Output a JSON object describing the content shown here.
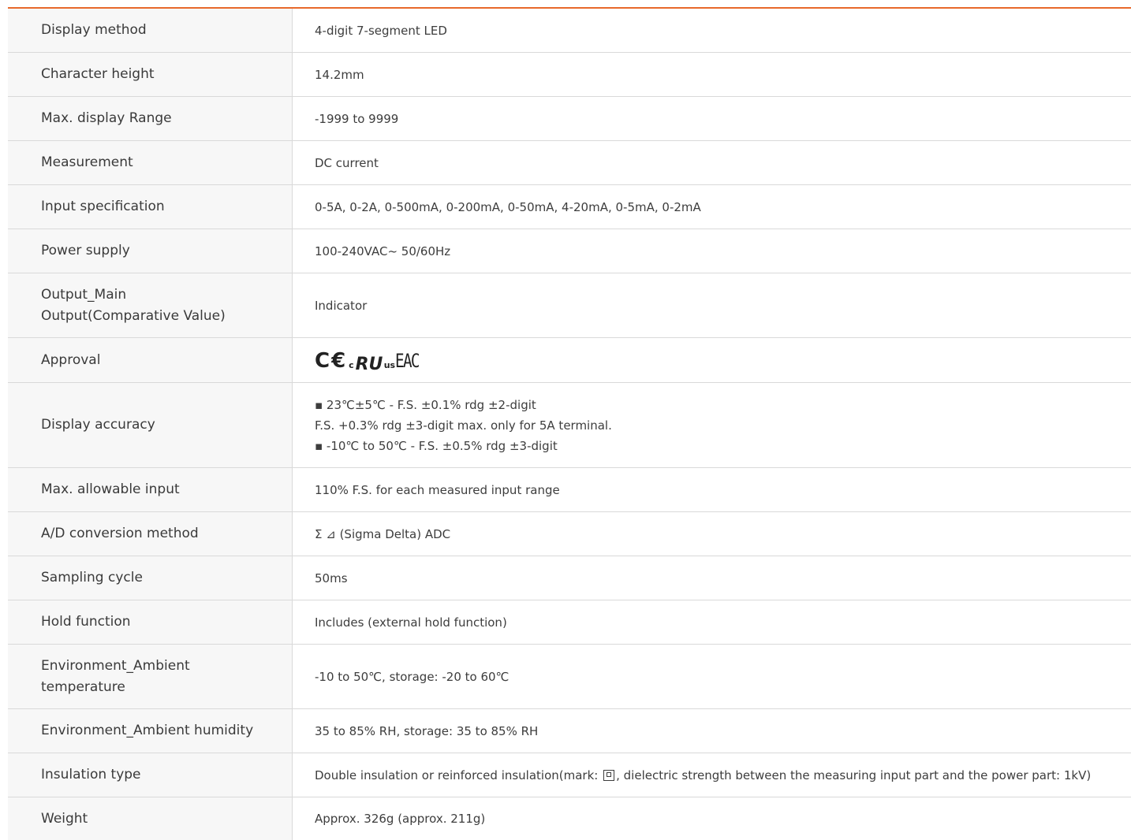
{
  "colors": {
    "accent": "#e8692b",
    "label_bg": "#f7f7f7",
    "border": "#d9d9d9"
  },
  "specs": [
    {
      "label": "Display method",
      "value": "4-digit 7-segment LED"
    },
    {
      "label": "Character height",
      "value": "14.2mm"
    },
    {
      "label": "Max. display Range",
      "value": "-1999 to 9999"
    },
    {
      "label": "Measurement",
      "value": "DC current"
    },
    {
      "label": "Input specification",
      "value": "0-5A, 0-2A, 0-500mA, 0-200mA, 0-50mA, 4-20mA, 0-5mA, 0-2mA"
    },
    {
      "label": "Power supply",
      "value": "100-240VAC~ 50/60Hz"
    },
    {
      "label": "Output_Main\nOutput(Comparative Value)",
      "value": "Indicator"
    },
    {
      "label": "Approval",
      "marks": {
        "ce": "C€",
        "ul_c": "c",
        "ul": "RU",
        "ul_us": "us",
        "eac": "EAC"
      }
    },
    {
      "label": "Display accuracy",
      "value": "▪ 23℃±5℃ - F.S. ±0.1% rdg ±2-digit\nF.S. +0.3% rdg ±3-digit max. only for 5A terminal.\n▪ -10℃ to 50℃ - F.S. ±0.5% rdg ±3-digit"
    },
    {
      "label": "Max. allowable input",
      "value": "110% F.S. for each measured input range"
    },
    {
      "label": "A/D conversion method",
      "value": "Σ ⊿ (Sigma Delta) ADC"
    },
    {
      "label": "Sampling cycle",
      "value": "50ms"
    },
    {
      "label": "Hold function",
      "value": "Includes (external hold function)"
    },
    {
      "label": "Environment_Ambient\ntemperature",
      "value": "-10 to 50℃, storage: -20 to 60℃"
    },
    {
      "label": "Environment_Ambient humidity",
      "value": "35 to 85% RH, storage: 35 to 85% RH"
    },
    {
      "label": "Insulation type",
      "value_pre": "Double insulation or reinforced insulation(mark: ",
      "value_post": ", dielectric strength between the measuring input part and the power part: 1kV)"
    },
    {
      "label": "Weight",
      "value": "Approx. 326g (approx. 211g)"
    }
  ]
}
